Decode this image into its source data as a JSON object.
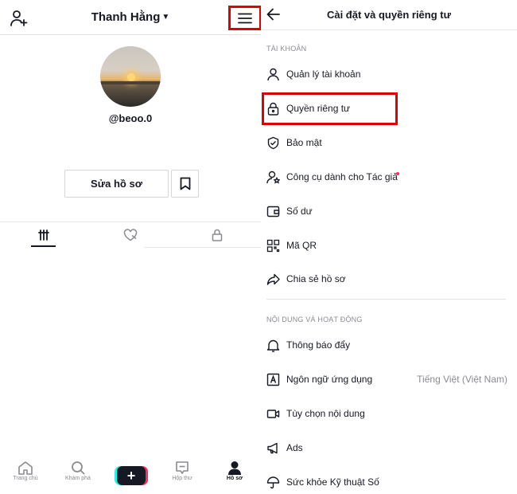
{
  "left": {
    "username": "Thanh Hằng",
    "handle": "@beoo.0",
    "edit_profile_label": "Sửa hồ sơ",
    "nav": [
      {
        "label": "Trang chủ",
        "icon": "home-icon"
      },
      {
        "label": "Khám phá",
        "icon": "search-icon"
      },
      {
        "label": "",
        "icon": "plus-icon"
      },
      {
        "label": "Hộp thư",
        "icon": "inbox-icon"
      },
      {
        "label": "Hồ sơ",
        "icon": "profile-icon"
      }
    ]
  },
  "right": {
    "title": "Cài đặt và quyền riêng tư",
    "section_account": "TÀI KHOẢN",
    "section_content": "NỘI DUNG VÀ HOẠT ĐỘNG",
    "account_items": [
      {
        "label": "Quản lý tài khoản",
        "icon": "user-icon"
      },
      {
        "label": "Quyền riêng tư",
        "icon": "lock-icon"
      },
      {
        "label": "Bảo mật",
        "icon": "shield-icon"
      },
      {
        "label": "Công cụ dành cho Tác giả",
        "icon": "creator-tools-icon"
      },
      {
        "label": "Số dư",
        "icon": "wallet-icon"
      },
      {
        "label": "Mã QR",
        "icon": "qr-code-icon"
      },
      {
        "label": "Chia sẻ hồ sơ",
        "icon": "share-icon"
      }
    ],
    "content_items": [
      {
        "label": "Thông báo đẩy",
        "icon": "bell-icon"
      },
      {
        "label": "Ngôn ngữ ứng dụng",
        "icon": "language-icon",
        "value": "Tiếng Việt (Việt Nam)"
      },
      {
        "label": "Tùy chọn nội dung",
        "icon": "video-icon"
      },
      {
        "label": "Ads",
        "icon": "megaphone-icon"
      },
      {
        "label": "Sức khỏe Kỹ thuật Số",
        "icon": "umbrella-icon"
      }
    ]
  },
  "colors": {
    "highlight": "#e00000",
    "accent_red": "#fe2c55",
    "accent_cyan": "#25f4ee",
    "muted": "#8a8b91"
  }
}
